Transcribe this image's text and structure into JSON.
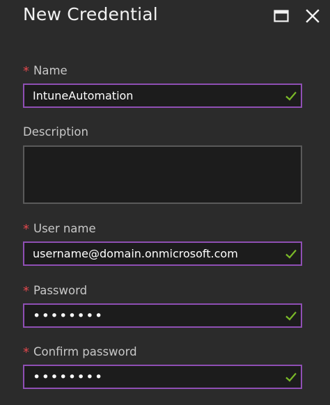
{
  "header": {
    "title": "New Credential"
  },
  "form": {
    "name": {
      "required_marker": "*",
      "label": "Name",
      "value": "IntuneAutomation"
    },
    "description": {
      "label": "Description",
      "value": ""
    },
    "user_name": {
      "required_marker": "*",
      "label": "User name",
      "value": "username@domain.onmicrosoft.com"
    },
    "password": {
      "required_marker": "*",
      "label": "Password",
      "masked_value": "••••••••"
    },
    "confirm_password": {
      "required_marker": "*",
      "label": "Confirm password",
      "masked_value": "••••••••"
    }
  },
  "colors": {
    "background": "#2b2b2b",
    "field_border_focus": "#8f4fb4",
    "required_asterisk": "#e0474c",
    "valid_check": "#7ab928"
  },
  "icons": {
    "maximize": "maximize-icon",
    "close": "close-icon",
    "valid": "checkmark-icon"
  }
}
